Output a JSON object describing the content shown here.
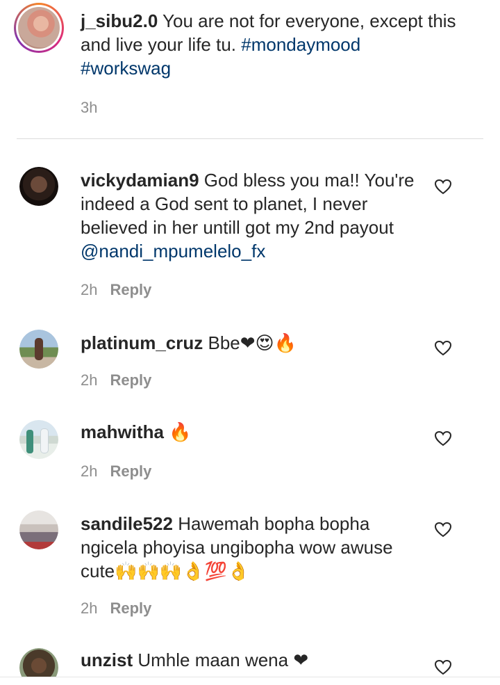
{
  "caption": {
    "username": "j_sibu2.0",
    "text": " You are not for everyone, except this and live your life tu. ",
    "hashtag1": "#mondaymood",
    "hashtag2": "#workswag",
    "time": "3h"
  },
  "comments": [
    {
      "username": "vickydamian9",
      "text": " God bless you ma!! You're indeed a God sent to planet, I never believed in her untill got my 2nd payout ",
      "mention": "@nandi_mpumelelo_fx",
      "time": "2h",
      "reply": "Reply"
    },
    {
      "username": "platinum_cruz",
      "text": " Bbe❤😍🔥",
      "time": "2h",
      "reply": "Reply"
    },
    {
      "username": "mahwitha",
      "text": " 🔥",
      "time": "2h",
      "reply": "Reply"
    },
    {
      "username": "sandile522",
      "text": " Hawemah bopha bopha ngicela phoyisa ungibopha wow awuse cute🙌🙌🙌👌💯👌",
      "time": "2h",
      "reply": "Reply"
    },
    {
      "username": "unzist",
      "text": " Umhle maan wena ❤"
    }
  ],
  "colors": {
    "text": "#262626",
    "link": "#00376b",
    "muted": "#8e8e8e",
    "divider": "#dbdbdb"
  },
  "icons": {
    "heart": "heart-outline-icon"
  }
}
